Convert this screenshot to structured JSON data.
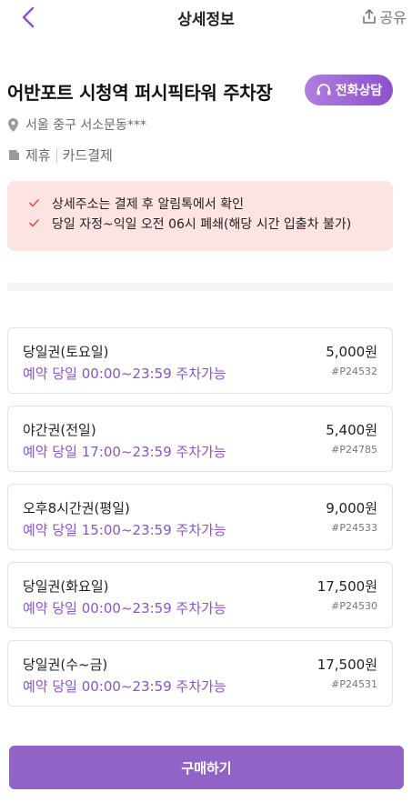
{
  "header": {
    "title": "상세정보",
    "share_label": "공유"
  },
  "lot": {
    "name": "어반포트 시청역 퍼시픽타워 주차장",
    "call_label": "전화상담",
    "address": "서울 중구 서소문동***",
    "tags": [
      "제휴",
      "카드결제"
    ]
  },
  "notice": {
    "lines": [
      "상세주소는 결제 후 알림톡에서 확인",
      "당일 자정~익일 오전 06시 폐쇄(해당 시간 입출차 불가)"
    ]
  },
  "tickets": [
    {
      "name": "당일권(토요일)",
      "desc": "예약 당일 00:00~23:59 주차가능",
      "price": "5,000원",
      "code": "#P24532"
    },
    {
      "name": "야간권(전일)",
      "desc": "예약 당일 17:00~23:59 주차가능",
      "price": "5,400원",
      "code": "#P24785"
    },
    {
      "name": "오후8시간권(평일)",
      "desc": "예약 당일 15:00~23:59 주차가능",
      "price": "9,000원",
      "code": "#P24533"
    },
    {
      "name": "당일권(화요일)",
      "desc": "예약 당일 00:00~23:59 주차가능",
      "price": "17,500원",
      "code": "#P24530"
    },
    {
      "name": "당일권(수~금)",
      "desc": "예약 당일 00:00~23:59 주차가능",
      "price": "17,500원",
      "code": "#P24531"
    }
  ],
  "footer": {
    "buy_label": "구매하기"
  },
  "colors": {
    "accent": "#8e4fcc",
    "notice_bg": "#fde3e1",
    "check": "#e0524a"
  },
  "icons": [
    "back-chevron-icon",
    "share-icon",
    "headset-icon",
    "location-pin-icon",
    "tag-icon",
    "check-icon"
  ]
}
